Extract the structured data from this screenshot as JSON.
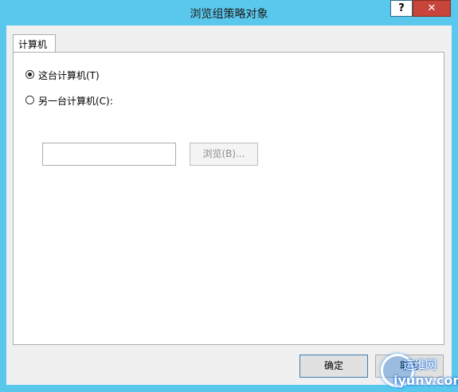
{
  "window": {
    "title": "浏览组策略对象",
    "help_label": "?",
    "close_label": "✕"
  },
  "tabs": [
    {
      "label": "计算机",
      "selected": true
    }
  ],
  "options": {
    "this_computer": {
      "label": "这台计算机(T)",
      "selected": true
    },
    "another_computer": {
      "label": "另一台计算机(C):",
      "selected": false
    }
  },
  "computer_name": {
    "value": "",
    "placeholder": ""
  },
  "browse_button": {
    "label": "浏览(B)...",
    "enabled": false
  },
  "footer": {
    "ok_label": "确定",
    "cancel_label": "取消"
  },
  "watermark": {
    "line1": "运维网",
    "line2": "iyunv.com"
  },
  "colors": {
    "title_bar": "#5ac8ec",
    "close_button": "#c7453a",
    "dialog_background": "#f0f0f0"
  }
}
